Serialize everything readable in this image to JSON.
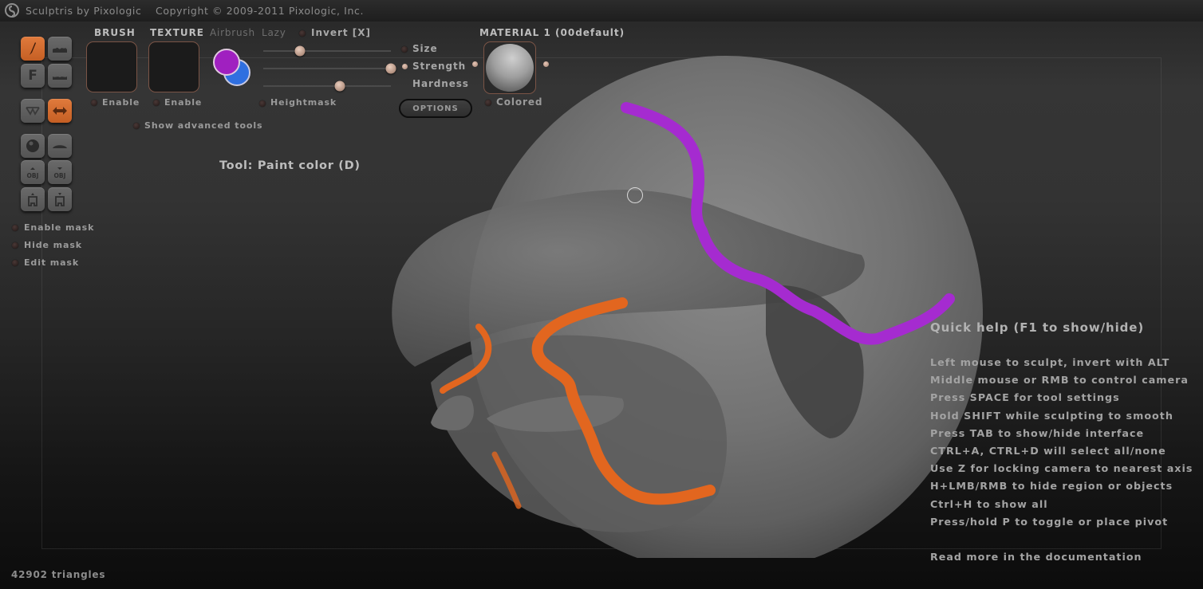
{
  "titlebar": {
    "app_name": "Sculptris by Pixologic",
    "copyright": "Copyright © 2009-2011 Pixologic, Inc."
  },
  "left_tools": {
    "buttons": [
      {
        "name": "paint-brush",
        "icon": "paintbrush-icon",
        "active": true
      },
      {
        "name": "crease-tool",
        "icon": "crease-icon",
        "active": false
      },
      {
        "name": "flatten-tool",
        "icon": "F",
        "active": false
      },
      {
        "name": "flatten-surface",
        "icon": "surface-icon",
        "active": false
      },
      {
        "name": "symmetry-toggle",
        "icon": "symmetry-icon",
        "active": false
      },
      {
        "name": "drag-tool",
        "icon": "double-arrow-icon",
        "active": true
      },
      {
        "name": "sphere-tool",
        "icon": "sphere-icon",
        "active": false
      },
      {
        "name": "plane-tool",
        "icon": "plane-icon",
        "active": false
      },
      {
        "name": "import-obj",
        "icon": "obj-up-icon",
        "active": false
      },
      {
        "name": "export-obj",
        "icon": "obj-down-icon",
        "active": false
      },
      {
        "name": "load-file",
        "icon": "file-up-icon",
        "active": false
      },
      {
        "name": "save-file",
        "icon": "file-down-icon",
        "active": false
      }
    ],
    "flatten_letter": "F",
    "obj_text": "OBJ",
    "mask_options": [
      {
        "label": "Enable mask",
        "checked": false
      },
      {
        "label": "Hide mask",
        "checked": false
      },
      {
        "label": "Edit mask",
        "checked": false
      }
    ]
  },
  "brush_panel": {
    "brush_label": "BRUSH",
    "texture_label": "TEXTURE",
    "brush_enable": "Enable",
    "texture_enable": "Enable",
    "show_advanced": "Show advanced tools",
    "airbrush_label": "Airbrush",
    "lazy_label": "Lazy",
    "invert_label": "Invert [X]",
    "heightmask_label": "Heightmask",
    "primary_color": "#a020c0",
    "secondary_color": "#2f6fe0",
    "sliders": [
      {
        "label": "Size",
        "value_fraction": 0.29
      },
      {
        "label": "Strength",
        "value_fraction": 1.0
      },
      {
        "label": "Hardness",
        "value_fraction": 0.6
      }
    ],
    "options_label": "OPTIONS"
  },
  "material_panel": {
    "title": "MATERIAL 1 (00default)",
    "colored_label": "Colored"
  },
  "tool_status": "Tool: Paint color (D)",
  "quick_help": {
    "title": "Quick help (F1 to show/hide)",
    "lines": [
      "Left mouse to sculpt, invert with ALT",
      "Middle mouse or RMB to control camera",
      "Press SPACE for tool settings",
      "Hold SHIFT while sculpting to smooth",
      "Press TAB to show/hide interface",
      "CTRL+A, CTRL+D will select all/none",
      "Use Z for locking camera to nearest axis",
      "H+LMB/RMB to hide region or objects",
      "Ctrl+H to show all",
      "Press/hold P to toggle or place pivot"
    ],
    "footer": "Read more in the documentation"
  },
  "status": {
    "triangles": "42902 triangles"
  },
  "paint_colors": {
    "purple": "#a52bd0",
    "orange": "#e2661f"
  }
}
